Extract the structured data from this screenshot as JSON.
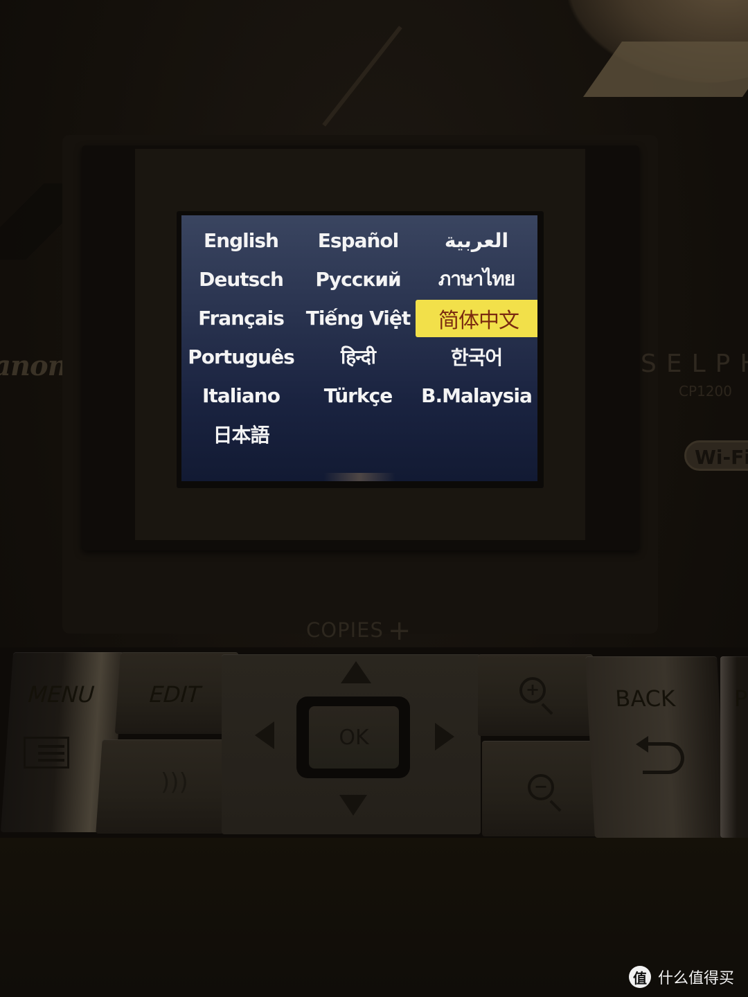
{
  "screen": {
    "languages": [
      {
        "label": "English"
      },
      {
        "label": "Español"
      },
      {
        "label": "العربية"
      },
      {
        "label": "Deutsch"
      },
      {
        "label": "Русский"
      },
      {
        "label": "ภาษาไทย"
      },
      {
        "label": "Français"
      },
      {
        "label": "Tiếng Việt"
      },
      {
        "label": "简体中文",
        "selected": true
      },
      {
        "label": "Português"
      },
      {
        "label": "हिन्दी"
      },
      {
        "label": "한국어"
      },
      {
        "label": "Italiano"
      },
      {
        "label": "Türkçe"
      },
      {
        "label": "B.Malaysia"
      },
      {
        "label": "日本語"
      }
    ],
    "selected_language": "简体中文",
    "colors": {
      "background": "#2a3450",
      "text": "#f4f4f4",
      "highlight": "#f2e04a",
      "highlight_text": "#7a2a10"
    }
  },
  "device": {
    "brand_partial": "anon",
    "series": "SELPHY",
    "model": "CP1200",
    "wifi_badge": "Wi-Fi"
  },
  "controls": {
    "copies_label": "COPIES",
    "copies_plus": "+",
    "menu_label": "MENU",
    "edit_label": "EDIT",
    "ok_label": "OK",
    "back_label": "BACK",
    "print_label": "P"
  },
  "watermark": {
    "badge": "值",
    "text": "什么值得买"
  }
}
